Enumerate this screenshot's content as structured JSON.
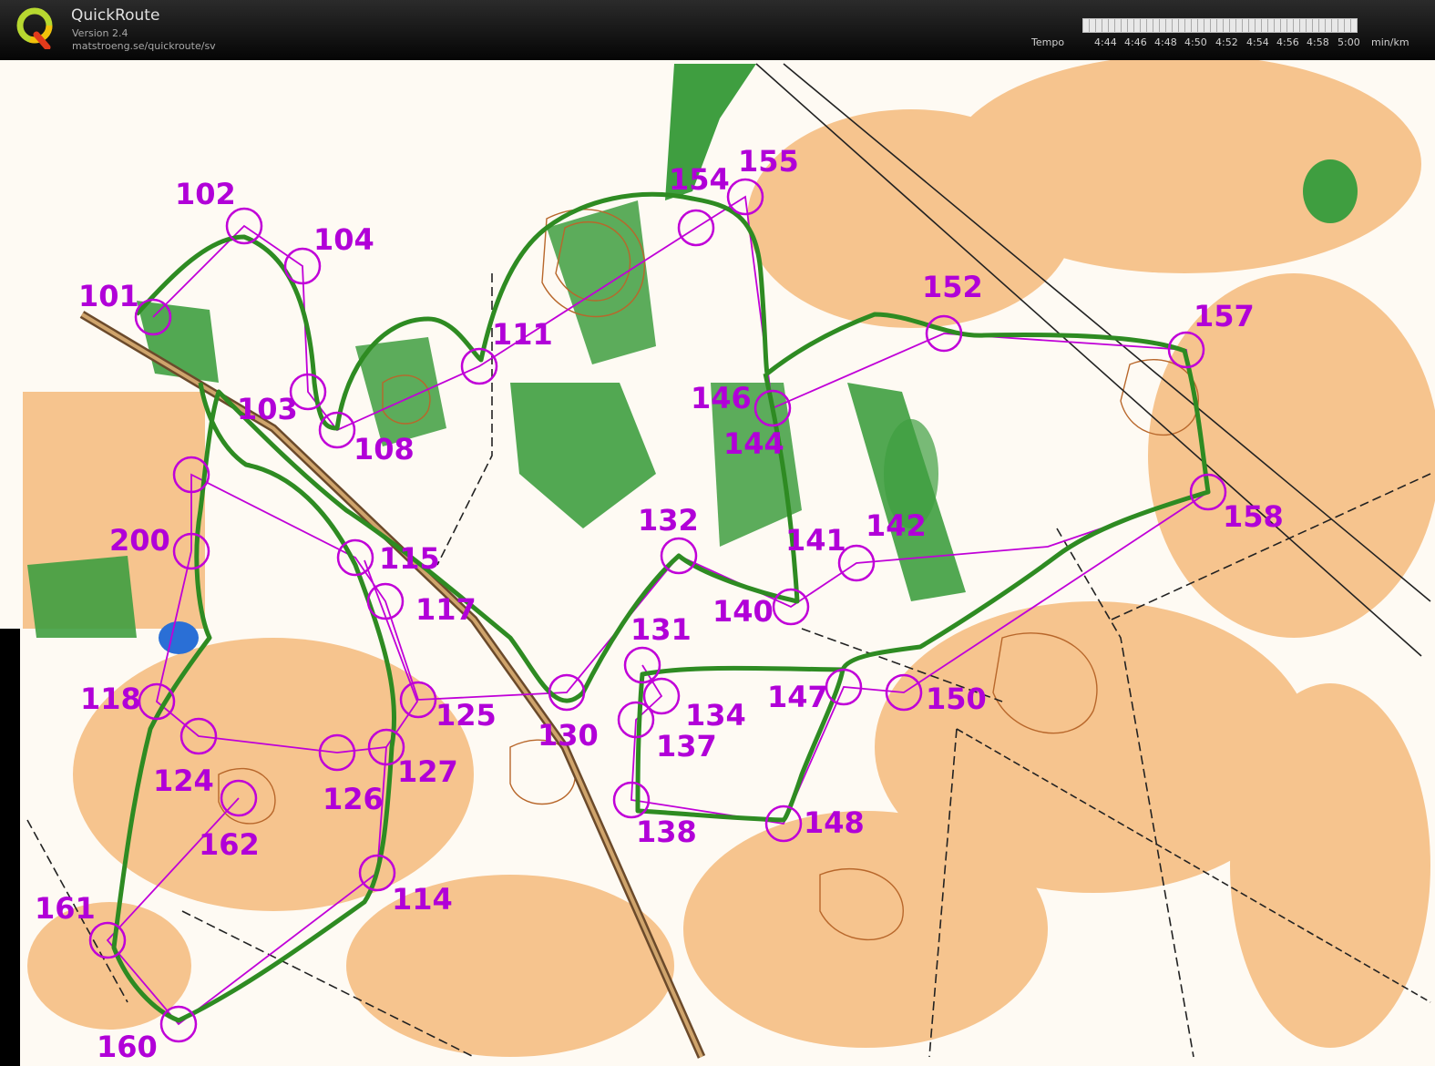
{
  "app": {
    "title": "QuickRoute",
    "version": "Version 2.4",
    "url": "matstroeng.se/quickroute/sv"
  },
  "tempo": {
    "label": "Tempo",
    "ticks": [
      "4:44",
      "4:46",
      "4:48",
      "4:50",
      "4:52",
      "4:54",
      "4:56",
      "4:58",
      "5:00"
    ],
    "unit": "min/km"
  },
  "colors": {
    "route": "#2e8b22",
    "course": "#c000d8",
    "terrain": "#f5c08a",
    "vegetation": "#3c9a3c"
  },
  "controls": [
    "101",
    "102",
    "103",
    "104",
    "108",
    "111",
    "114",
    "115",
    "117",
    "118",
    "124",
    "125",
    "126",
    "127",
    "130",
    "131",
    "132",
    "134",
    "137",
    "138",
    "140",
    "141",
    "142",
    "144",
    "146",
    "147",
    "148",
    "150",
    "152",
    "154",
    "155",
    "157",
    "158",
    "160",
    "161",
    "162",
    "200"
  ]
}
